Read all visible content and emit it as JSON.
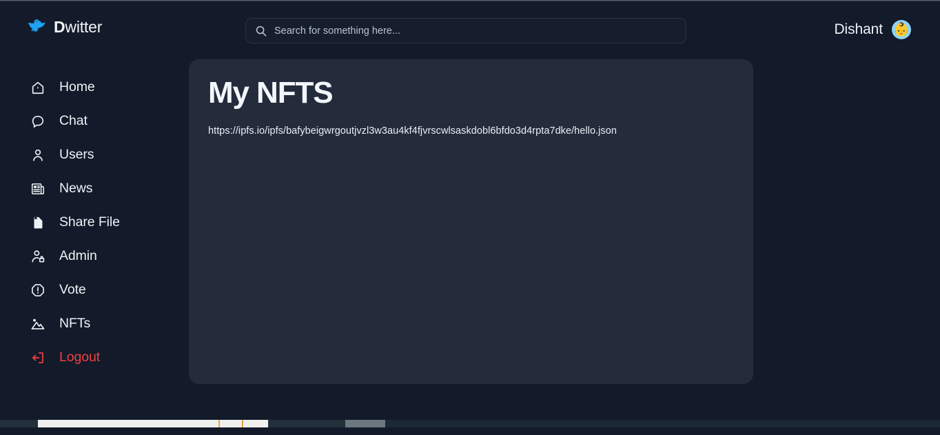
{
  "app": {
    "brand": {
      "initial": "D",
      "rest": "witter",
      "icon": "bird-icon"
    },
    "background_color": "#131a29",
    "card_color": "#242c3c",
    "accent_color": "#1da1f2",
    "danger_color": "#f04141"
  },
  "search": {
    "icon": "search-icon",
    "placeholder": "Search for something here...",
    "value": ""
  },
  "user": {
    "name": "Dishant",
    "avatar_icon": "avatar-person-icon",
    "avatar_emoji": "👶"
  },
  "sidebar": {
    "items": [
      {
        "label": "Home",
        "icon": "home-icon",
        "active": false
      },
      {
        "label": "Chat",
        "icon": "chat-bubble-icon",
        "active": false
      },
      {
        "label": "Users",
        "icon": "user-icon",
        "active": false
      },
      {
        "label": "News",
        "icon": "newspaper-icon",
        "active": false
      },
      {
        "label": "Share File",
        "icon": "document-icon",
        "active": false
      },
      {
        "label": "Admin",
        "icon": "user-lock-icon",
        "active": false
      },
      {
        "label": "Vote",
        "icon": "alert-octagon-icon",
        "active": false
      },
      {
        "label": "NFTs",
        "icon": "image-icon",
        "active": false
      },
      {
        "label": "Logout",
        "icon": "logout-icon",
        "active": false,
        "danger": true
      }
    ]
  },
  "main": {
    "title": "My NFTS",
    "nft_links": [
      "https://ipfs.io/ipfs/bafybeigwrgoutjvzl3w3au4kf4fjvrscwlsaskdobl6bfdo3d4rpta7dke/hello.json"
    ]
  }
}
